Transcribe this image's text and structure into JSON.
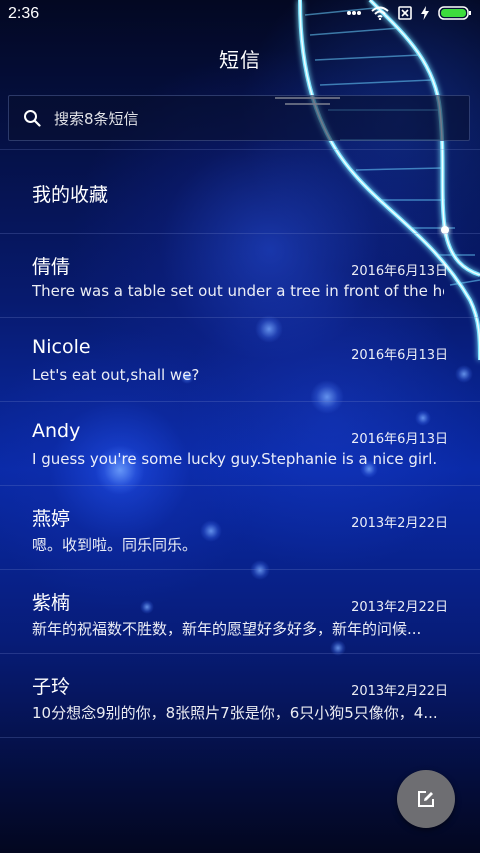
{
  "status_bar": {
    "time": "2:36",
    "icons": [
      "dots-icon",
      "wifi-icon",
      "no-sim-icon",
      "charging-icon",
      "battery-icon"
    ],
    "battery_color": "#3ddc3d"
  },
  "header": {
    "title": "短信"
  },
  "search": {
    "placeholder": "搜索8条短信"
  },
  "favorites": {
    "label": "我的收藏"
  },
  "messages": [
    {
      "name": "倩倩",
      "date": "2016年6月13日",
      "preview": "There was a table set out under a tree in front of the ho..."
    },
    {
      "name": "Nicole",
      "date": "2016年6月13日",
      "preview": "Let's eat out,shall we?"
    },
    {
      "name": "Andy",
      "date": "2016年6月13日",
      "preview": "I guess you're some lucky guy.Stephanie is a nice girl."
    },
    {
      "name": "燕婷",
      "date": "2013年2月22日",
      "preview": "嗯。收到啦。同乐同乐。"
    },
    {
      "name": "紫楠",
      "date": "2013年2月22日",
      "preview": "新年的祝福数不胜数，新年的愿望好多好多，新年的问候..."
    },
    {
      "name": "子玲",
      "date": "2013年2月22日",
      "preview": "10分想念9别的你，8张照片7张是你，6只小狗5只像你，4..."
    }
  ],
  "compose_button": {
    "icon": "compose-icon",
    "color": "#6e6e72"
  }
}
